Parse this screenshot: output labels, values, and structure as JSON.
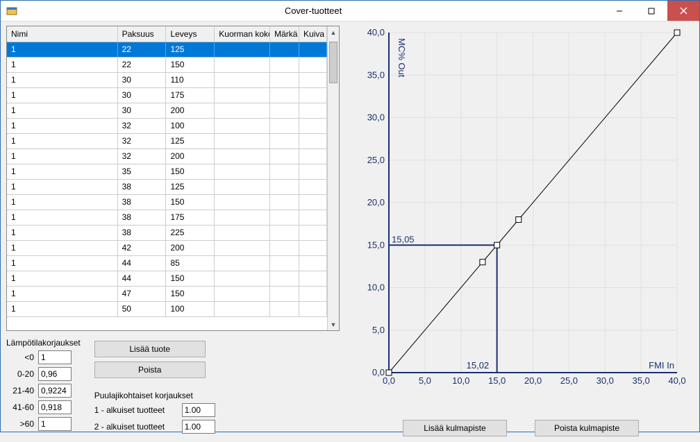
{
  "window": {
    "title": "Cover-tuotteet"
  },
  "grid": {
    "headers": {
      "nimi": "Nimi",
      "paksuus": "Paksuus",
      "leveys": "Leveys",
      "kuorma": "Kuorman koko",
      "marka": "Märkä",
      "kuiva": "Kuiva"
    },
    "rows": [
      {
        "nimi": "1",
        "paksuus": "22",
        "leveys": "125",
        "sel": true
      },
      {
        "nimi": "1",
        "paksuus": "22",
        "leveys": "150"
      },
      {
        "nimi": "1",
        "paksuus": "30",
        "leveys": "110"
      },
      {
        "nimi": "1",
        "paksuus": "30",
        "leveys": "175"
      },
      {
        "nimi": "1",
        "paksuus": "30",
        "leveys": "200"
      },
      {
        "nimi": "1",
        "paksuus": "32",
        "leveys": "100"
      },
      {
        "nimi": "1",
        "paksuus": "32",
        "leveys": "125"
      },
      {
        "nimi": "1",
        "paksuus": "32",
        "leveys": "200"
      },
      {
        "nimi": "1",
        "paksuus": "35",
        "leveys": "150"
      },
      {
        "nimi": "1",
        "paksuus": "38",
        "leveys": "125"
      },
      {
        "nimi": "1",
        "paksuus": "38",
        "leveys": "150"
      },
      {
        "nimi": "1",
        "paksuus": "38",
        "leveys": "175"
      },
      {
        "nimi": "1",
        "paksuus": "38",
        "leveys": "225"
      },
      {
        "nimi": "1",
        "paksuus": "42",
        "leveys": "200"
      },
      {
        "nimi": "1",
        "paksuus": "44",
        "leveys": "85"
      },
      {
        "nimi": "1",
        "paksuus": "44",
        "leveys": "150"
      },
      {
        "nimi": "1",
        "paksuus": "47",
        "leveys": "150"
      },
      {
        "nimi": "1",
        "paksuus": "50",
        "leveys": "100"
      }
    ]
  },
  "temp_corr": {
    "title": "Lämpötilakorjaukset",
    "rows": [
      {
        "label": "<0",
        "value": "1"
      },
      {
        "label": "0-20",
        "value": "0,96"
      },
      {
        "label": "21-40",
        "value": "0,9224"
      },
      {
        "label": "41-60",
        "value": "0,918"
      },
      {
        "label": ">60",
        "value": "1"
      }
    ]
  },
  "species_corr": {
    "title": "Puulajikohtaiset korjaukset",
    "rows": [
      {
        "label": "1 - alkuiset tuotteet",
        "value": "1.00"
      },
      {
        "label": "2 - alkuiset tuotteet",
        "value": "1.00"
      }
    ]
  },
  "buttons": {
    "add_product": "Lisää tuote",
    "remove": "Poista",
    "add_point": "Lisää kulmapiste",
    "remove_point": "Poista kulmapiste"
  },
  "chart_data": {
    "type": "line",
    "xlabel": "FMI In",
    "ylabel": "MC% Out",
    "xlim": [
      0,
      40
    ],
    "ylim": [
      0,
      40
    ],
    "xticks": [
      0,
      5,
      10,
      15,
      20,
      25,
      30,
      35,
      40
    ],
    "yticks": [
      0,
      5,
      10,
      15,
      20,
      25,
      30,
      35,
      40
    ],
    "points": [
      {
        "x": 0,
        "y": 0
      },
      {
        "x": 13,
        "y": 13
      },
      {
        "x": 15,
        "y": 15
      },
      {
        "x": 18,
        "y": 18
      },
      {
        "x": 40,
        "y": 40
      }
    ],
    "crosshair": {
      "x": 15,
      "y": 15,
      "x_label": "15,02",
      "y_label": "15,05"
    }
  }
}
